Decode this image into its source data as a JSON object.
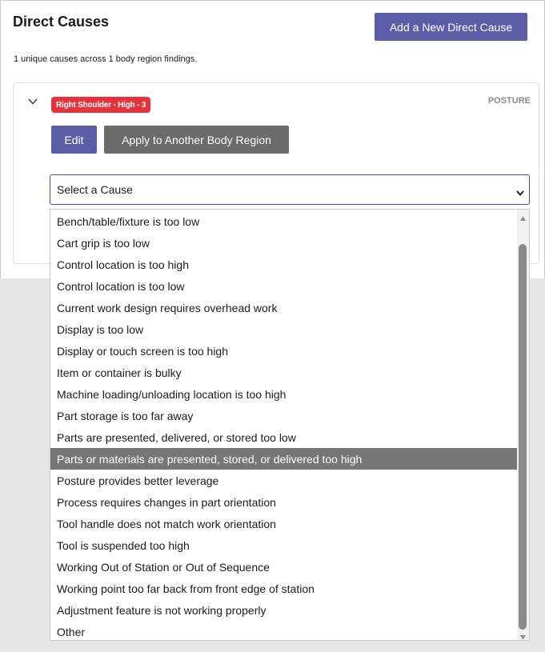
{
  "header": {
    "title": "Direct Causes",
    "add_button_label": "Add a New Direct Cause",
    "summary": "1 unique causes across 1 body region findings."
  },
  "finding": {
    "badge_label": "Right Shoulder - High - 3",
    "category": "POSTURE",
    "edit_label": "Edit",
    "apply_label": "Apply to Another Body Region",
    "badge_color": "#e8323b"
  },
  "cause_select": {
    "value": "Select a Cause",
    "options": [
      "Bench/table/fixture is too low",
      "Cart grip is too low",
      "Control location is too high",
      "Control location is too low",
      "Current work design requires overhead work",
      "Display is too low",
      "Display or touch screen is too high",
      "Item or container is bulky",
      "Machine loading/unloading location is too high",
      "Part storage is too far away",
      "Parts are presented, delivered, or stored too low",
      "Parts or materials are presented, stored, or delivered too high",
      "Posture provides better leverage",
      "Process requires changes in part orientation",
      "Tool handle does not match work orientation",
      "Tool is suspended too high",
      "Working Out of Station or Out of Sequence",
      "Working point too far back from front edge of station",
      "Adjustment feature is not working properly",
      "Other"
    ],
    "highlighted_index": 11
  },
  "colors": {
    "primary_button": "#5b5ea6",
    "secondary_button": "#6b6b6b",
    "highlight": "#767676"
  }
}
